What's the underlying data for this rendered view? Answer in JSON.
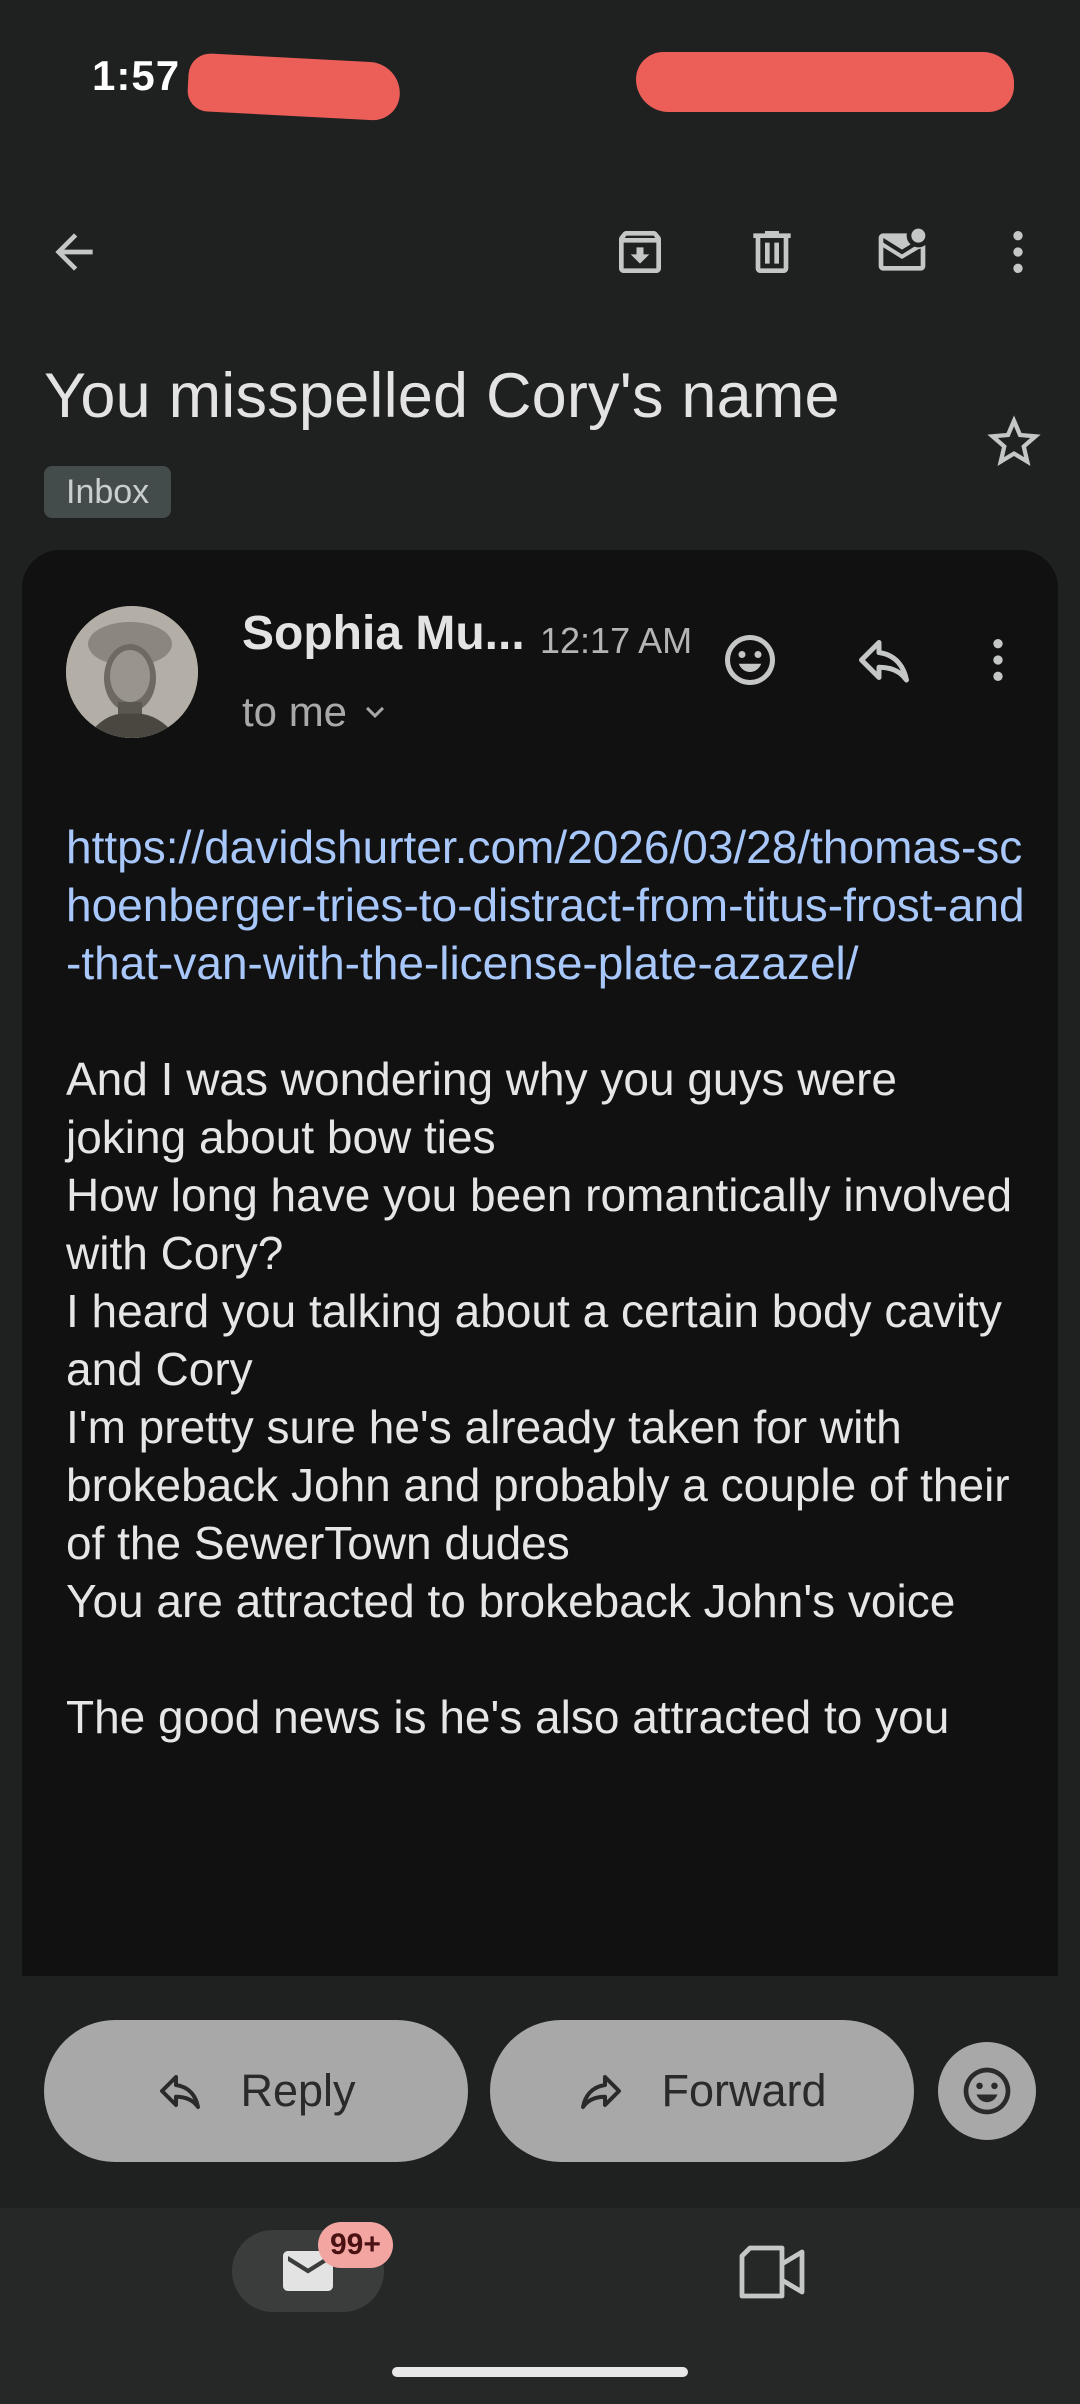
{
  "status_bar": {
    "time": "1:57"
  },
  "toolbar": {
    "back_icon": "arrow-left-icon",
    "archive_icon": "archive-icon",
    "delete_icon": "trash-icon",
    "mark_unread_icon": "mail-unread-icon",
    "more_icon": "more-vert-icon"
  },
  "email": {
    "subject": "You misspelled Cory's name",
    "label": "Inbox",
    "sender": "Sophia Mu...",
    "time": "12:17 AM",
    "recipient": "to me",
    "link": "https://davidshurter.com/2026/03/28/thomas-schoenberger-tries-to-distract-from-titus-frost-and-that-van-with-the-license-plate-azazel/",
    "body_lines": [
      "And I was wondering why you guys were joking about bow ties",
      "How long have you been romantically involved with Cory?",
      "I heard you talking about a certain body cavity and Cory",
      "I'm pretty sure he's already taken for with brokeback John and probably a couple of their of the SewerTown dudes",
      "You are attracted to brokeback John's voice"
    ],
    "closing": "The good news is he's also attracted to you"
  },
  "actions": {
    "reply": "Reply",
    "forward": "Forward"
  },
  "bottom_nav": {
    "mail_badge": "99+"
  },
  "colors": {
    "background": "#1f2020",
    "card": "#111111",
    "link": "#a8c7fa",
    "pill": "#a8a8a8",
    "badge": "#f3a5a2"
  }
}
